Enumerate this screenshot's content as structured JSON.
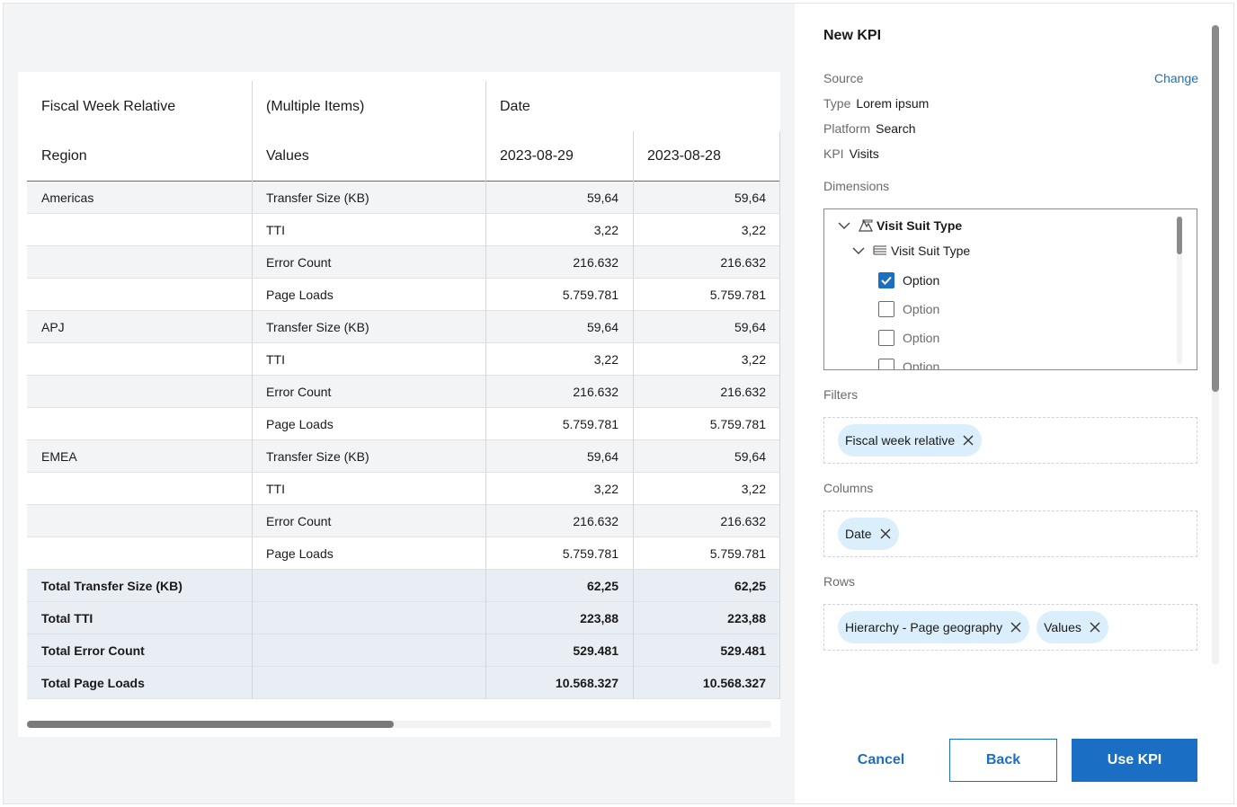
{
  "table": {
    "header_row1": {
      "col1": "Fiscal Week Relative",
      "col2": "(Multiple Items)",
      "col3": "Date"
    },
    "header_row2": {
      "col1": "Region",
      "col2": "Values",
      "col3": "2023-08-29",
      "col4": "2023-08-28"
    },
    "rows": [
      {
        "region": "Americas",
        "value": "Transfer Size (KB)",
        "d1": "59,64",
        "d2": "59,64"
      },
      {
        "region": "",
        "value": "TTI",
        "d1": "3,22",
        "d2": "3,22"
      },
      {
        "region": "",
        "value": "Error Count",
        "d1": "216.632",
        "d2": "216.632"
      },
      {
        "region": "",
        "value": "Page Loads",
        "d1": "5.759.781",
        "d2": "5.759.781"
      },
      {
        "region": "APJ",
        "value": "Transfer Size (KB)",
        "d1": "59,64",
        "d2": "59,64"
      },
      {
        "region": "",
        "value": "TTI",
        "d1": "3,22",
        "d2": "3,22"
      },
      {
        "region": "",
        "value": "Error Count",
        "d1": "216.632",
        "d2": "216.632"
      },
      {
        "region": "",
        "value": "Page Loads",
        "d1": "5.759.781",
        "d2": "5.759.781"
      },
      {
        "region": "EMEA",
        "value": "Transfer Size (KB)",
        "d1": "59,64",
        "d2": "59,64"
      },
      {
        "region": "",
        "value": "TTI",
        "d1": "3,22",
        "d2": "3,22"
      },
      {
        "region": "",
        "value": "Error Count",
        "d1": "216.632",
        "d2": "216.632"
      },
      {
        "region": "",
        "value": "Page Loads",
        "d1": "5.759.781",
        "d2": "5.759.781"
      }
    ],
    "totals": [
      {
        "label": "Total Transfer Size (KB)",
        "d1": "62,25",
        "d2": "62,25"
      },
      {
        "label": "Total TTI",
        "d1": "223,88",
        "d2": "223,88"
      },
      {
        "label": "Total Error Count",
        "d1": "529.481",
        "d2": "529.481"
      },
      {
        "label": "Total Page Loads",
        "d1": "10.568.327",
        "d2": "10.568.327"
      }
    ]
  },
  "panel": {
    "title": "New KPI",
    "source_label": "Source",
    "change_link": "Change",
    "type_label": "Type",
    "type_value": "Lorem ipsum",
    "platform_label": "Platform",
    "platform_value": "Search",
    "kpi_label": "KPI",
    "kpi_value": "Visits",
    "dimensions_label": "Dimensions",
    "dimensions_tree": {
      "parent": "Visit Suit Type",
      "child": "Visit Suit Type",
      "options": [
        {
          "label": "Option",
          "checked": true
        },
        {
          "label": "Option",
          "checked": false
        },
        {
          "label": "Option",
          "checked": false
        },
        {
          "label": "Option",
          "checked": false
        }
      ]
    },
    "filters_label": "Filters",
    "filters": [
      "Fiscal week relative"
    ],
    "columns_label": "Columns",
    "columns": [
      "Date"
    ],
    "rows_label": "Rows",
    "rows": [
      "Hierarchy - Page geography",
      "Values"
    ],
    "buttons": {
      "cancel": "Cancel",
      "back": "Back",
      "use": "Use KPI"
    }
  },
  "colors": {
    "accent": "#1a6fc4",
    "chip": "#dbeefc",
    "total_row": "#e9eef5",
    "alt_row": "#f3f4f6"
  },
  "icons": [
    "chevron-down-icon",
    "hierarchy-icon",
    "list-icon",
    "checkmark-icon",
    "close-icon"
  ]
}
